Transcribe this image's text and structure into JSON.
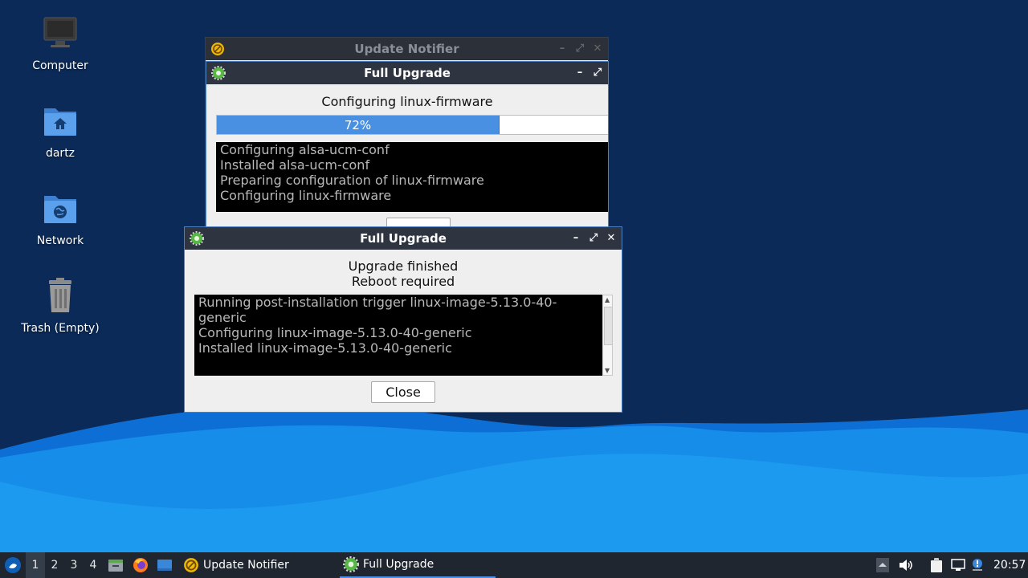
{
  "desktop": {
    "icons": [
      {
        "label": "Computer",
        "icon": "computer-icon"
      },
      {
        "label": "dartz",
        "icon": "home-folder-icon"
      },
      {
        "label": "Network",
        "icon": "network-folder-icon"
      },
      {
        "label": "Trash (Empty)",
        "icon": "trash-icon"
      }
    ]
  },
  "update_notifier_window": {
    "title": "Update Notifier"
  },
  "back_window": {
    "title": "Full Upgrade",
    "status": "Configuring linux-firmware",
    "progress_percent": 72,
    "progress_label": "72%",
    "log": [
      "Configuring alsa-ucm-conf",
      "Installed alsa-ucm-conf",
      "Preparing configuration of linux-firmware",
      "Configuring linux-firmware"
    ]
  },
  "front_window": {
    "title": "Full Upgrade",
    "status_line1": "Upgrade finished",
    "status_line2": "Reboot required",
    "log": [
      "Running post-installation trigger linux-image-5.13.0-40-generic",
      "Configuring linux-image-5.13.0-40-generic",
      "Installed linux-image-5.13.0-40-generic"
    ],
    "close_label": "Close"
  },
  "taskbar": {
    "workspaces": [
      "1",
      "2",
      "3",
      "4"
    ],
    "active_workspace": "1",
    "tasks": [
      {
        "label": "Update Notifier",
        "icon": "update-notifier-icon"
      },
      {
        "label": "Full Upgrade",
        "icon": "gear-icon",
        "active": true
      }
    ],
    "clock": "20:57"
  },
  "colors": {
    "accent": "#4b8fe6",
    "titlebar": "#2e3440",
    "progress_fill": "#4a90e2",
    "desktop_bg": "#0b2a57",
    "wave_light": "#1e90f0"
  }
}
